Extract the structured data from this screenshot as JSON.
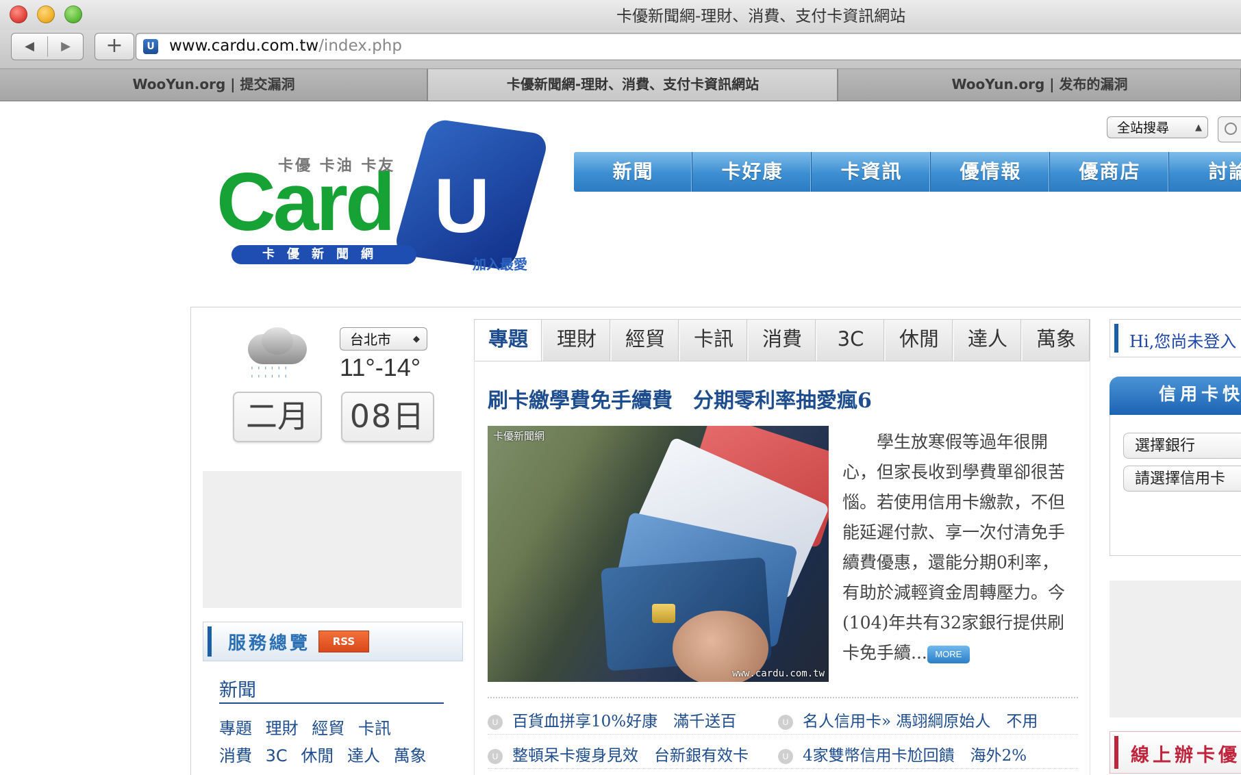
{
  "window": {
    "title": "卡優新聞網-理財、消費、支付卡資訊網站",
    "url_host": "www.cardu.com.tw",
    "url_path": "/index.php"
  },
  "tabs": [
    {
      "label": "WooYun.org | 提交漏洞",
      "active": false
    },
    {
      "label": "卡優新聞網-理財、消費、支付卡資訊網站",
      "active": true
    },
    {
      "label": "WooYun.org | 发布的漏洞",
      "active": false
    }
  ],
  "logo": {
    "tagline": "卡優 卡油 卡友",
    "wordmark": "Card",
    "u_letter": "U",
    "subtitle": "卡優新聞網",
    "join": "加入最愛"
  },
  "search": {
    "scope": "全站搜尋"
  },
  "main_nav": [
    "新聞",
    "卡好康",
    "卡資訊",
    "優情報",
    "優商店",
    "討論"
  ],
  "weather": {
    "city": "台北市",
    "temperature": "11°-14°",
    "month": "二月",
    "day": "08日"
  },
  "services": {
    "title": "服務總覽",
    "rss": "RSS",
    "section": "新聞",
    "links_row1": [
      "專題",
      "理財",
      "經貿",
      "卡訊"
    ],
    "links_row2": [
      "消費",
      "3C",
      "休閒",
      "達人",
      "萬象"
    ]
  },
  "category_tabs": [
    "專題",
    "理財",
    "經貿",
    "卡訊",
    "消費",
    "3C",
    "休閒",
    "達人",
    "萬象"
  ],
  "featured": {
    "headline": "刷卡繳學費免手續費　分期零利率抽愛瘋6",
    "summary": "學生放寒假等過年很開心，但家長收到學費單卻很苦惱。若使用信用卡繳款，不但能延遲付款、享一次付清免手續費優惠，還能分期0利率，有助於減輕資金周轉壓力。今(104)年共有32家銀行提供刷卡免手續...",
    "more_label": "MORE",
    "photo_watermark_top": "卡優新聞網",
    "photo_watermark_bottom": "www.cardu.com.tw"
  },
  "news_list": [
    {
      "text": "百貨血拼享10%好康　滿千送百"
    },
    {
      "text": "名人信用卡» 馮翊綱原始人　不用"
    },
    {
      "text": "整頓呆卡瘦身見效　台新銀有效卡"
    },
    {
      "text": "4家雙幣信用卡尬回饋　海外2%"
    }
  ],
  "right": {
    "login_text": "Hi,您尚未登入",
    "cc_header": "信用卡快",
    "select_bank": "選擇銀行",
    "select_card": "請選擇信用卡",
    "apply_text": "線上辦卡優"
  },
  "colors": {
    "nav_blue": "#3c8ed2",
    "link_blue": "#1e4d8f",
    "logo_green": "#17a235",
    "accent_red": "#c0243c",
    "rss_orange": "#d9481a"
  }
}
